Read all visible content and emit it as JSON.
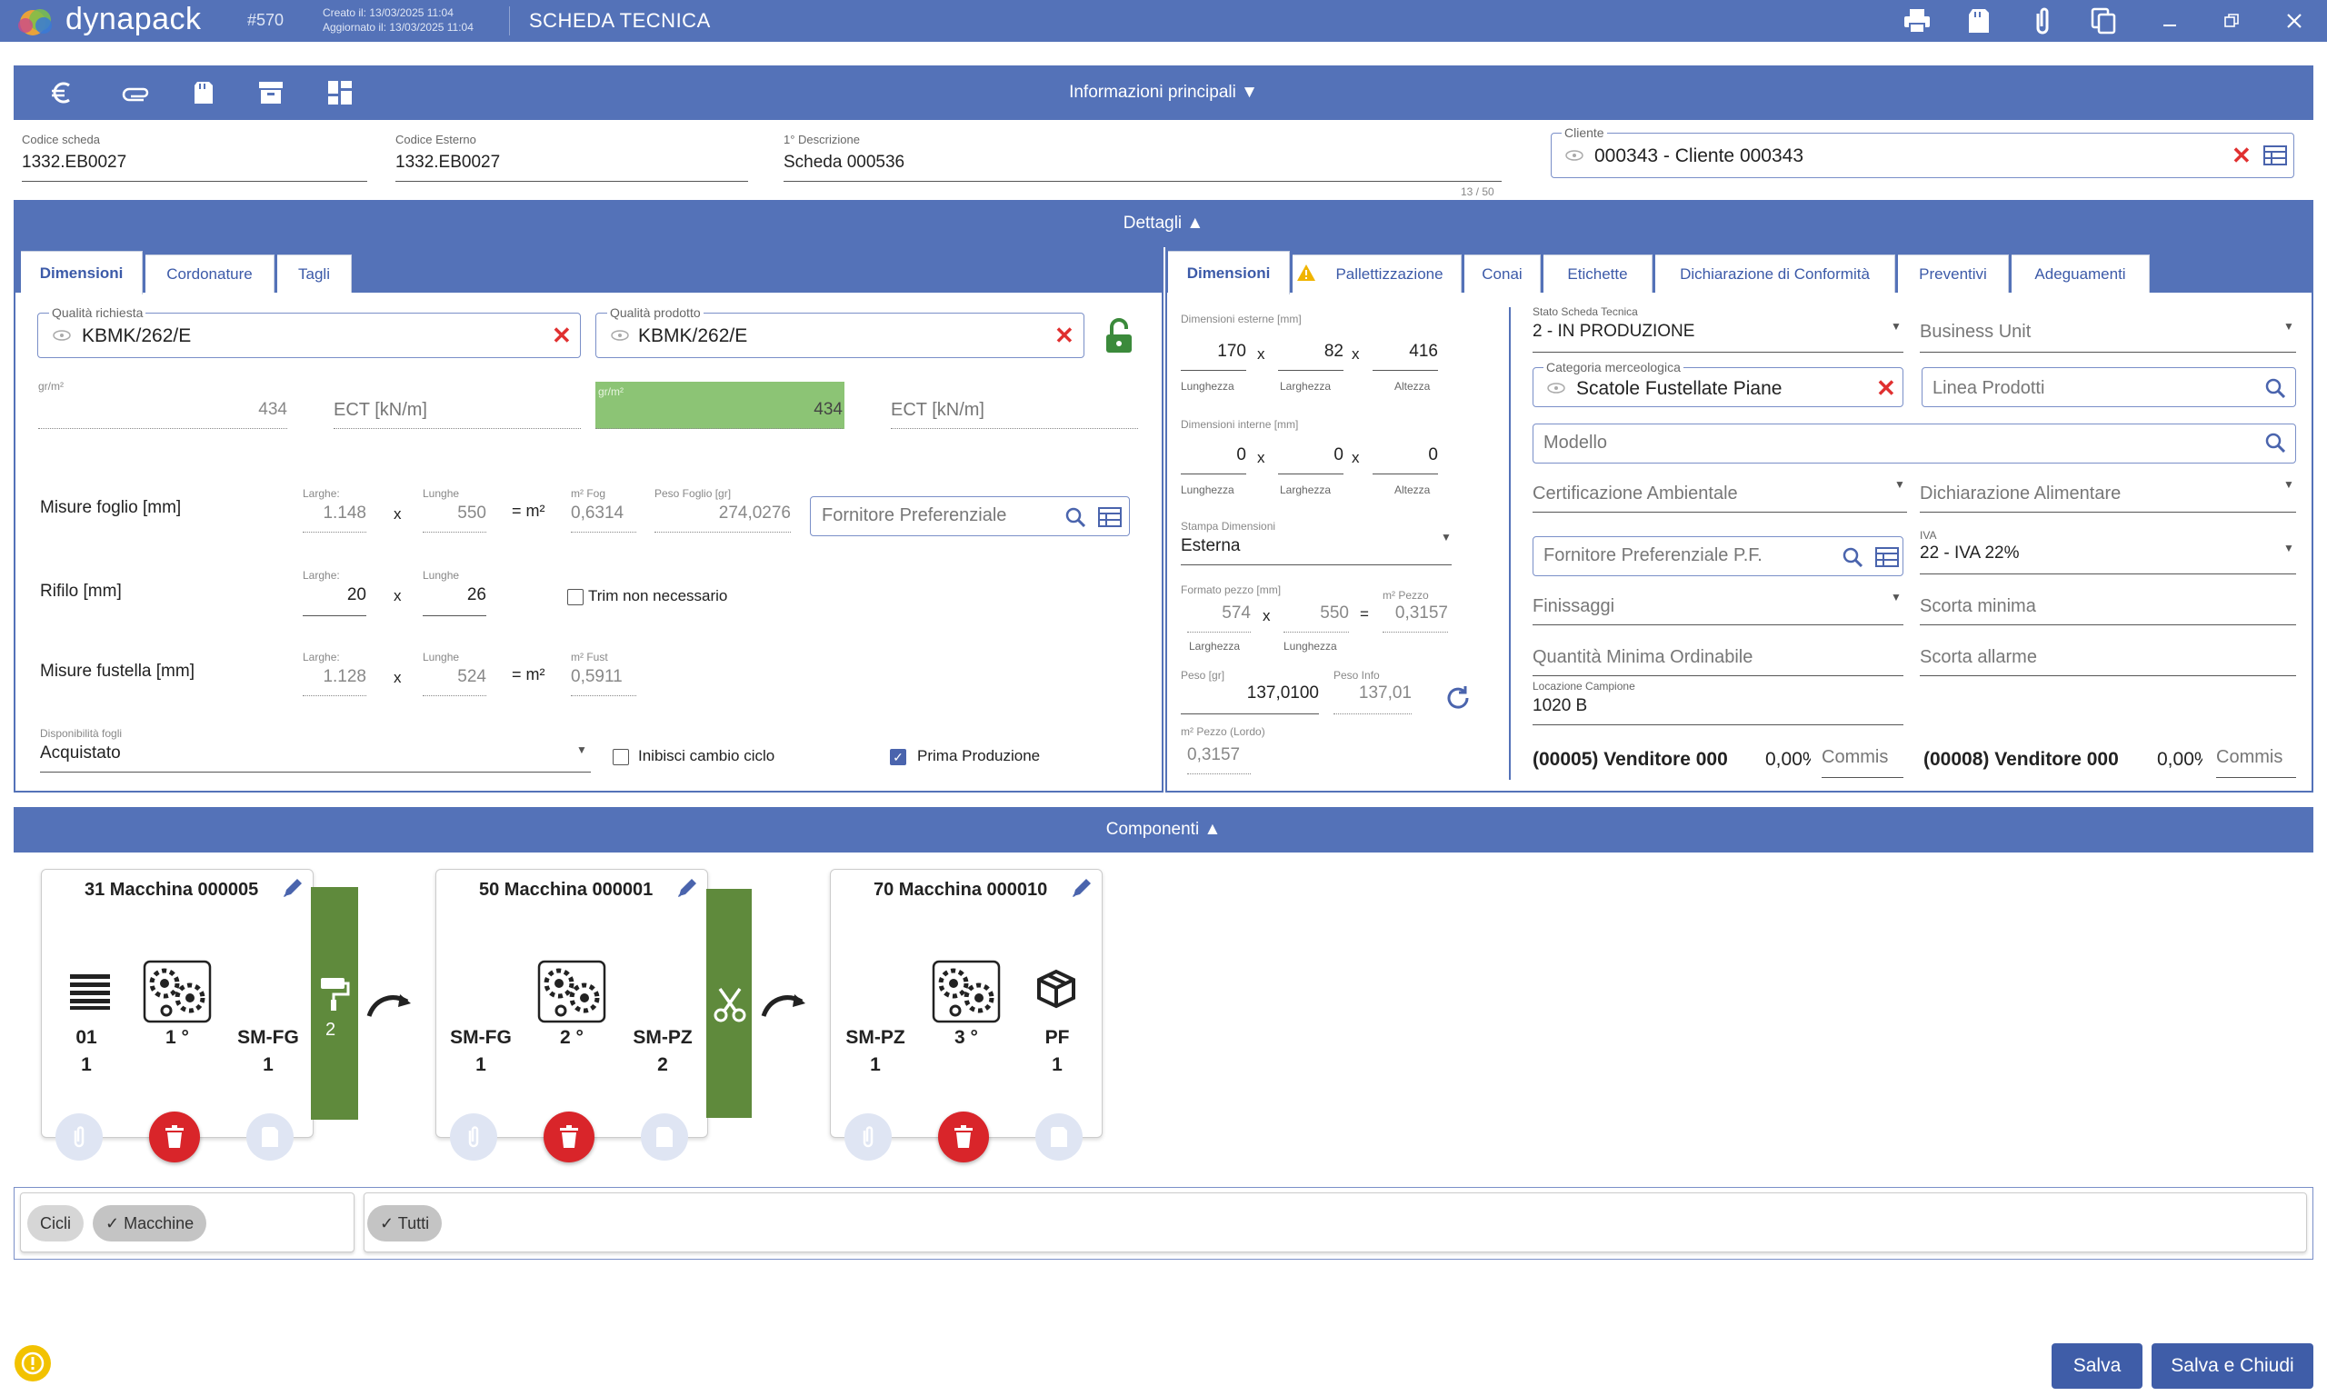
{
  "titlebar": {
    "brand": "dynapack",
    "record_number": "#570",
    "created": "Creato il: 13/03/2025 11:04",
    "updated": "Aggiornato il: 13/03/2025 11:04",
    "title": "SCHEDA TECNICA"
  },
  "main_header": {
    "label": "Informazioni principali ▼"
  },
  "main_info": {
    "codice_scheda_label": "Codice scheda",
    "codice_scheda": "1332.EB0027",
    "codice_esterno_label": "Codice Esterno",
    "codice_esterno": "1332.EB0027",
    "descrizione_label": "1° Descrizione",
    "descrizione": "Scheda 000536",
    "descrizione_counter": "13 / 50",
    "cliente_label": "Cliente",
    "cliente": "000343 - Cliente 000343"
  },
  "dettagli_header": {
    "label": "Dettagli ▲"
  },
  "left_tabs": [
    "Dimensioni",
    "Cordonature",
    "Tagli"
  ],
  "left": {
    "qualita_richiesta_label": "Qualità richiesta",
    "qualita_richiesta": "KBMK/262/E",
    "qualita_prodotto_label": "Qualità prodotto",
    "qualita_prodotto": "KBMK/262/E",
    "grm_label": "gr/m²",
    "grm_value": "434",
    "ect_label": "ECT [kN/m]",
    "grm2_label": "gr/m²",
    "grm2_value": "434",
    "ect2_label": "ECT [kN/m]",
    "misure_foglio_label": "Misure foglio [mm]",
    "larghe_label": "Larghe:",
    "lunghe_label": "Lunghe",
    "foglio_larghe": "1.148",
    "foglio_lunghe": "550",
    "x": "x",
    "eq_m2": "= m²",
    "m2_fog_label": "m² Fog",
    "m2_fog": "0,6314",
    "peso_foglio_label": "Peso Foglio [gr]",
    "peso_foglio": "274,0276",
    "fornitore_pref_placeholder": "Fornitore Preferenziale",
    "rifilo_label": "Rifilo [mm]",
    "rifilo_larghe_label": "Larghe:",
    "rifilo_larghe": "20",
    "rifilo_lunghe_label": "Lunghe",
    "rifilo_lunghe": "26",
    "trim_label": "Trim non necessario",
    "misure_fustella_label": "Misure fustella [mm]",
    "fust_larghe_label": "Larghe:",
    "fust_larghe": "1.128",
    "fust_lunghe_label": "Lunghe",
    "fust_lunghe": "524",
    "m2_fust_label": "m² Fust",
    "m2_fust": "0,5911",
    "disponibilita_label": "Disponibilità fogli",
    "disponibilita": "Acquistato",
    "inibisci_label": "Inibisci cambio ciclo",
    "prima_produzione_label": "Prima Produzione"
  },
  "right_tabs": [
    "Dimensioni",
    "Pallettizzazione",
    "Conai",
    "Etichette",
    "Dichiarazione di Conformità",
    "Preventivi",
    "Adeguamenti"
  ],
  "right_dims": {
    "esterne_label": "Dimensioni esterne [mm]",
    "est_lung": "170",
    "est_larg": "82",
    "est_alt": "416",
    "lunghezza": "Lunghezza",
    "larghezza": "Larghezza",
    "altezza": "Altezza",
    "interne_label": "Dimensioni interne [mm]",
    "int_lung": "0",
    "int_larg": "0",
    "int_alt": "0",
    "stampa_label": "Stampa Dimensioni",
    "stampa": "Esterna",
    "formato_label": "Formato pezzo [mm]",
    "formato_larg": "574",
    "formato_lung": "550",
    "m2_pezzo_label": "m² Pezzo",
    "m2_pezzo": "0,3157",
    "eq": "=",
    "peso_label": "Peso [gr]",
    "peso": "137,0100",
    "peso_info_label": "Peso Info",
    "peso_info": "137,01",
    "m2_lordo_label": "m² Pezzo (Lordo)",
    "m2_lordo": "0,3157"
  },
  "right_form": {
    "stato_label": "Stato Scheda Tecnica",
    "stato": "2 - IN PRODUZIONE",
    "business_unit": "Business Unit",
    "categoria_label": "Categoria merceologica",
    "categoria": "Scatole Fustellate Piane",
    "linea_prodotti": "Linea Prodotti",
    "modello": "Modello",
    "certificazione": "Certificazione Ambientale",
    "dichiarazione_alimentare": "Dichiarazione Alimentare",
    "fornitore_pf": "Fornitore Preferenziale P.F.",
    "iva_label": "IVA",
    "iva": "22 - IVA 22%",
    "finissaggi": "Finissaggi",
    "scorta_minima": "Scorta minima",
    "quantita_minima": "Quantità Minima Ordinabile",
    "scorta_allarme": "Scorta allarme",
    "locazione_label": "Locazione Campione",
    "locazione": "1020 B",
    "venditore1": "(00005) Venditore 000",
    "venditore1_perc": "0,00%",
    "commis": "Commis",
    "venditore2": "(00008) Venditore 000",
    "venditore2_perc": "0,00%",
    "commis2": "Commis"
  },
  "componenti_header": {
    "label": "Componenti ▲"
  },
  "machines": [
    {
      "title": "31 Macchina 000005",
      "in_code": "01",
      "in_qty": "1",
      "step": "1 °",
      "out_code": "SM-FG",
      "out_qty": "1"
    },
    {
      "title": "50 Macchina 000001",
      "in_code": "SM-FG",
      "in_qty": "1",
      "step": "2 °",
      "out_code": "SM-PZ",
      "out_qty": "2"
    },
    {
      "title": "70 Macchina 000010",
      "in_code": "SM-PZ",
      "in_qty": "1",
      "step": "3 °",
      "out_code": "PF",
      "out_qty": "1"
    }
  ],
  "connector1_count": "2",
  "filters": {
    "cicli": "Cicli",
    "macchine": "✓ Macchine",
    "tutti": "✓ Tutti"
  },
  "footer": {
    "salva": "Salva",
    "salva_chiudi": "Salva e Chiudi"
  }
}
